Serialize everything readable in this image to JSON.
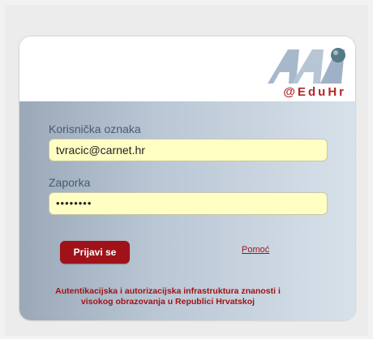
{
  "logo": {
    "text": "@EduHr",
    "accent": "#b0282c",
    "shape": "#a8b8cc",
    "globe": "#557a88"
  },
  "form": {
    "username_label": "Korisnička oznaka",
    "username_value": "tvracic@carnet.hr",
    "password_label": "Zaporka",
    "password_value": "••••••••"
  },
  "actions": {
    "login_label": "Prijavi se",
    "help_label": "Pomoć"
  },
  "footer": {
    "line1": "Autentikacijska i autorizacijska infrastruktura znanosti i",
    "line2": "visokog obrazovanja u Republici Hrvatskoj"
  },
  "colors": {
    "brand_red": "#a01218",
    "input_bg": "#ffffc4",
    "label": "#4a5a70"
  }
}
